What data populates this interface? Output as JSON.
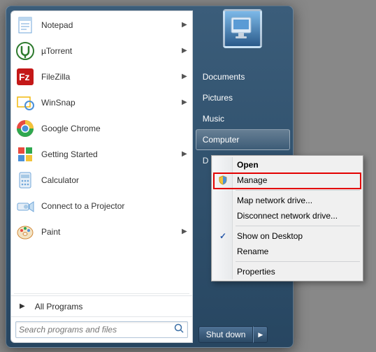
{
  "programs": [
    {
      "label": "Notepad",
      "has_sub": true,
      "icon_bg": "#e3f1fb",
      "icon_fg": "#3a6ea5",
      "glyph": "notepad"
    },
    {
      "label": "µTorrent",
      "has_sub": true,
      "icon_bg": "#ffffff",
      "icon_fg": "#2e7a2e",
      "glyph": "utorrent"
    },
    {
      "label": "FileZilla",
      "has_sub": true,
      "icon_bg": "#c41818",
      "icon_fg": "#ffffff",
      "glyph": "fz"
    },
    {
      "label": "WinSnap",
      "has_sub": true,
      "icon_bg": "#ffffff",
      "icon_fg": "#f2b90c",
      "glyph": "winsnap"
    },
    {
      "label": "Google Chrome",
      "has_sub": false,
      "icon_bg": "#ffffff",
      "icon_fg": "#e84a3f",
      "glyph": "chrome"
    },
    {
      "label": "Getting Started",
      "has_sub": true,
      "icon_bg": "#ffffff",
      "icon_fg": "#4aa3df",
      "glyph": "getstarted"
    },
    {
      "label": "Calculator",
      "has_sub": false,
      "icon_bg": "#e1ecf6",
      "icon_fg": "#3a6ea5",
      "glyph": "calc"
    },
    {
      "label": "Connect to a Projector",
      "has_sub": false,
      "icon_bg": "#eef3f8",
      "icon_fg": "#3a6ea5",
      "glyph": "projector"
    },
    {
      "label": "Paint",
      "has_sub": true,
      "icon_bg": "#ffffff",
      "icon_fg": "#d28a3a",
      "glyph": "paint"
    }
  ],
  "all_programs_label": "All Programs",
  "search_placeholder": "Search programs and files",
  "right_links": [
    "Documents",
    "Pictures",
    "Music",
    "Computer"
  ],
  "right_links_hidden_initial": "D",
  "shutdown_label": "Shut down",
  "context_menu": {
    "items": [
      {
        "label": "Open",
        "bold": true
      },
      {
        "label": "Manage",
        "icon": "shield",
        "highlight": true
      },
      {
        "sep": true
      },
      {
        "label": "Map network drive..."
      },
      {
        "label": "Disconnect network drive..."
      },
      {
        "sep": true
      },
      {
        "label": "Show on Desktop",
        "icon": "check"
      },
      {
        "label": "Rename"
      },
      {
        "sep": true
      },
      {
        "label": "Properties"
      }
    ]
  }
}
